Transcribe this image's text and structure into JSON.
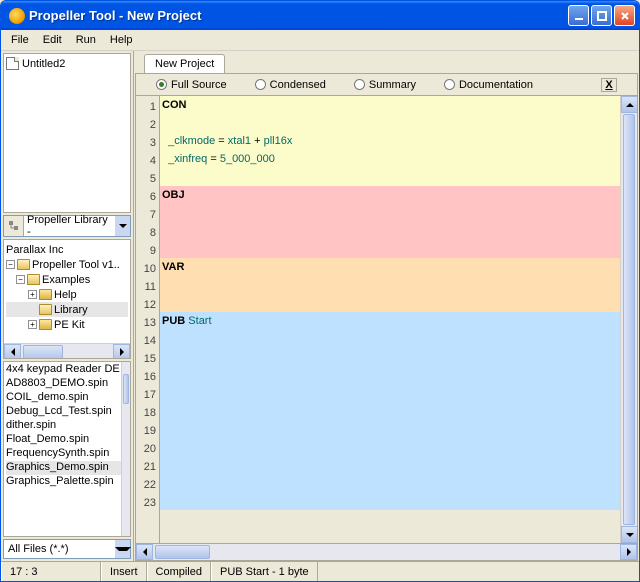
{
  "window": {
    "title": "Propeller Tool - New Project"
  },
  "menu": {
    "file": "File",
    "edit": "Edit",
    "run": "Run",
    "help": "Help"
  },
  "recent": {
    "items": [
      "Untitled2"
    ]
  },
  "library_selector": {
    "label": "Propeller Library - "
  },
  "tree": {
    "root": "Parallax Inc",
    "node1": "Propeller Tool v1..",
    "node2": "Examples",
    "leaf1": "Help",
    "leaf2": "Library",
    "leaf3": "PE Kit"
  },
  "files": {
    "items": [
      "4x4 keypad Reader DE",
      "AD8803_DEMO.spin",
      "COIL_demo.spin",
      "Debug_Lcd_Test.spin",
      "dither.spin",
      "Float_Demo.spin",
      "FrequencySynth.spin",
      "Graphics_Demo.spin",
      "Graphics_Palette.spin"
    ],
    "selected_index": 7
  },
  "filter": {
    "label": "All Files (*.*)"
  },
  "tabs": {
    "active": "New Project"
  },
  "view": {
    "full": "Full Source",
    "condensed": "Condensed",
    "summary": "Summary",
    "doc": "Documentation",
    "close": "X"
  },
  "code": {
    "lines": [
      {
        "n": 1,
        "cls": "con",
        "html": "<span class='kw'>CON</span>"
      },
      {
        "n": 2,
        "cls": "con",
        "html": ""
      },
      {
        "n": 3,
        "cls": "con",
        "html": "  <span class='ident'>_clkmode</span> <span class='op'>=</span> <span class='ident'>xtal1</span> <span class='op'>+</span> <span class='ident'>pll16x</span>"
      },
      {
        "n": 4,
        "cls": "con",
        "html": "  <span class='ident'>_xinfreq</span> <span class='op'>=</span> <span class='num'>5_000_000</span>"
      },
      {
        "n": 5,
        "cls": "con",
        "html": ""
      },
      {
        "n": 6,
        "cls": "obj",
        "html": "<span class='kw'>OBJ</span>"
      },
      {
        "n": 7,
        "cls": "obj",
        "html": ""
      },
      {
        "n": 8,
        "cls": "obj",
        "html": ""
      },
      {
        "n": 9,
        "cls": "obj",
        "html": ""
      },
      {
        "n": 10,
        "cls": "var",
        "html": "<span class='kw'>VAR</span>"
      },
      {
        "n": 11,
        "cls": "var",
        "html": ""
      },
      {
        "n": 12,
        "cls": "var",
        "html": ""
      },
      {
        "n": 13,
        "cls": "pub",
        "html": "<span class='kw'>PUB</span> <span class='ident'>Start</span>"
      },
      {
        "n": 14,
        "cls": "pub",
        "html": ""
      },
      {
        "n": 15,
        "cls": "pub",
        "html": ""
      },
      {
        "n": 16,
        "cls": "pub",
        "html": ""
      },
      {
        "n": 17,
        "cls": "pub",
        "html": ""
      },
      {
        "n": 18,
        "cls": "pub",
        "html": ""
      },
      {
        "n": 19,
        "cls": "pub",
        "html": ""
      },
      {
        "n": 20,
        "cls": "pub",
        "html": ""
      },
      {
        "n": 21,
        "cls": "pub",
        "html": ""
      },
      {
        "n": 22,
        "cls": "pub",
        "html": ""
      },
      {
        "n": 23,
        "cls": "pub",
        "html": ""
      }
    ]
  },
  "status": {
    "pos": "17 : 3",
    "insert": "Insert",
    "compiled": "Compiled",
    "info": "PUB Start  -  1 byte"
  }
}
